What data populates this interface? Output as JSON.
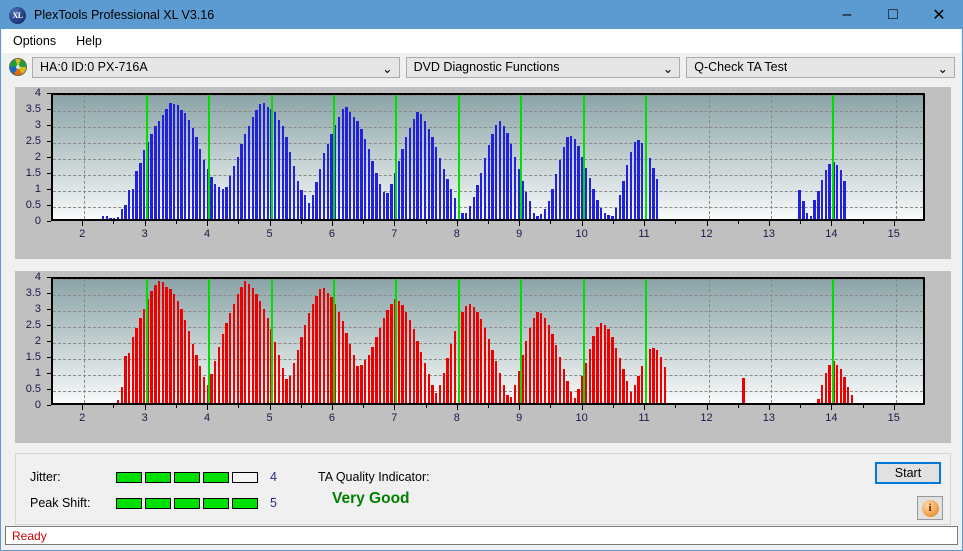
{
  "window": {
    "title": "PlexTools Professional XL V3.16",
    "icon": "XL",
    "minimize": "–",
    "maximize": "□",
    "close": "✕"
  },
  "menubar": {
    "items": [
      {
        "label": "Options"
      },
      {
        "label": "Help"
      }
    ]
  },
  "toolbar": {
    "drive_icon": "disc-icon",
    "drive_select": {
      "value": "HA:0 ID:0  PX-716A",
      "chevron": "⌄"
    },
    "function_select": {
      "value": "DVD Diagnostic Functions",
      "chevron": "⌄"
    },
    "test_select": {
      "value": "Q-Check TA Test",
      "chevron": "⌄"
    }
  },
  "indicators": {
    "jitter": {
      "label": "Jitter:",
      "value": "4",
      "filled": 4,
      "total": 5
    },
    "peak_shift": {
      "label": "Peak Shift:",
      "value": "5",
      "filled": 5,
      "total": 5
    },
    "ta_quality": {
      "label": "TA Quality Indicator:",
      "value": "Very Good",
      "color": "#008000"
    }
  },
  "buttons": {
    "start": "Start",
    "info": "i"
  },
  "status": {
    "text": "Ready"
  },
  "chart_data": [
    {
      "id": "ta-test-pit-lengths",
      "type": "bar",
      "title": "",
      "xlabel": "",
      "ylabel": "",
      "color": "#2222dd",
      "xlim": [
        1.5,
        15.5
      ],
      "ylim": [
        0,
        4
      ],
      "yticks": [
        0,
        0.5,
        1,
        1.5,
        2,
        2.5,
        3,
        3.5,
        4
      ],
      "ytick_labels": [
        "0",
        "0.5",
        "1",
        "1.5",
        "2",
        "2.5",
        "3",
        "3.5",
        "4"
      ],
      "xticks": [
        2,
        3,
        4,
        5,
        6,
        7,
        8,
        9,
        10,
        11,
        12,
        13,
        14,
        15
      ],
      "xtick_labels": [
        "2",
        "3",
        "4",
        "5",
        "6",
        "7",
        "8",
        "9",
        "10",
        "11",
        "12",
        "13",
        "14",
        "15"
      ],
      "grid": true,
      "markers": [
        3,
        4,
        5,
        6,
        7,
        8,
        9,
        10,
        11,
        14
      ],
      "marker_color": "#00e000",
      "x": [
        2.3,
        2.36,
        2.42,
        2.48,
        2.54,
        2.6,
        2.66,
        2.72,
        2.78,
        2.84,
        2.9,
        2.96,
        3.02,
        3.08,
        3.14,
        3.2,
        3.26,
        3.32,
        3.38,
        3.44,
        3.5,
        3.56,
        3.62,
        3.68,
        3.74,
        3.8,
        3.86,
        3.92,
        3.98,
        4.04,
        4.1,
        4.16,
        4.22,
        4.28,
        4.34,
        4.4,
        4.46,
        4.52,
        4.58,
        4.64,
        4.7,
        4.76,
        4.82,
        4.88,
        4.94,
        5.0,
        5.06,
        5.12,
        5.18,
        5.24,
        5.3,
        5.36,
        5.42,
        5.48,
        5.54,
        5.6,
        5.66,
        5.72,
        5.78,
        5.84,
        5.9,
        5.96,
        6.02,
        6.08,
        6.14,
        6.2,
        6.26,
        6.32,
        6.38,
        6.44,
        6.5,
        6.56,
        6.62,
        6.68,
        6.74,
        6.8,
        6.86,
        6.92,
        6.98,
        7.04,
        7.1,
        7.16,
        7.22,
        7.28,
        7.34,
        7.4,
        7.46,
        7.52,
        7.58,
        7.64,
        7.7,
        7.76,
        7.82,
        7.88,
        7.94,
        8.0,
        8.06,
        8.12,
        8.18,
        8.24,
        8.3,
        8.36,
        8.42,
        8.48,
        8.54,
        8.6,
        8.66,
        8.72,
        8.78,
        8.84,
        8.9,
        8.96,
        9.02,
        9.08,
        9.14,
        9.2,
        9.26,
        9.32,
        9.38,
        9.44,
        9.5,
        9.56,
        9.62,
        9.68,
        9.74,
        9.8,
        9.86,
        9.92,
        9.98,
        10.04,
        10.1,
        10.16,
        10.22,
        10.28,
        10.34,
        10.4,
        10.46,
        10.52,
        10.58,
        10.64,
        10.7,
        10.76,
        10.82,
        10.88,
        10.94,
        11.0,
        11.06,
        11.12,
        11.18,
        13.46,
        13.52,
        13.58,
        13.64,
        13.7,
        13.76,
        13.82,
        13.88,
        13.94,
        14.0,
        14.06,
        14.12,
        14.18
      ],
      "values": [
        0.08,
        0.08,
        0.02,
        0.02,
        0.06,
        0.3,
        0.45,
        0.9,
        0.95,
        1.5,
        1.75,
        2.15,
        2.4,
        2.65,
        2.9,
        3.05,
        3.25,
        3.45,
        3.62,
        3.6,
        3.55,
        3.4,
        3.3,
        3.1,
        2.85,
        2.55,
        2.2,
        1.85,
        1.55,
        1.3,
        1.1,
        1.0,
        0.95,
        1.0,
        1.35,
        1.65,
        1.95,
        2.35,
        2.65,
        2.9,
        3.2,
        3.4,
        3.58,
        3.62,
        3.5,
        3.45,
        3.35,
        3.1,
        2.9,
        2.55,
        2.1,
        1.65,
        1.2,
        0.9,
        0.75,
        0.5,
        0.75,
        1.15,
        1.55,
        2.05,
        2.35,
        2.65,
        2.95,
        3.2,
        3.45,
        3.5,
        3.35,
        3.2,
        3.05,
        2.8,
        2.5,
        2.2,
        1.8,
        1.45,
        1.1,
        0.85,
        0.8,
        1.1,
        1.45,
        1.8,
        2.2,
        2.55,
        2.85,
        3.12,
        3.35,
        3.28,
        3.05,
        2.8,
        2.55,
        2.25,
        1.9,
        1.55,
        1.25,
        0.95,
        0.65,
        0.4,
        0.2,
        0.18,
        0.4,
        0.7,
        1.05,
        1.45,
        1.9,
        2.3,
        2.65,
        2.95,
        3.05,
        2.9,
        2.7,
        2.35,
        1.95,
        1.55,
        1.2,
        0.85,
        0.55,
        0.2,
        0.1,
        0.15,
        0.3,
        0.55,
        0.95,
        1.4,
        1.85,
        2.25,
        2.55,
        2.6,
        2.5,
        2.28,
        1.95,
        1.6,
        1.28,
        0.95,
        0.6,
        0.35,
        0.18,
        0.12,
        0.1,
        0.35,
        0.75,
        1.2,
        1.7,
        2.1,
        2.4,
        2.48,
        2.38,
        2.18,
        1.9,
        1.58,
        1.25,
        0.9,
        0.55,
        0.2,
        0.08,
        0.6,
        0.88,
        1.22,
        1.52,
        1.72,
        1.78,
        1.7,
        1.52,
        1.2,
        0.85,
        0.55,
        0.25,
        0.08
      ]
    },
    {
      "id": "ta-test-land-lengths",
      "type": "bar",
      "title": "",
      "xlabel": "",
      "ylabel": "",
      "color": "#ee0000",
      "xlim": [
        1.5,
        15.5
      ],
      "ylim": [
        0,
        4
      ],
      "yticks": [
        0,
        0.5,
        1,
        1.5,
        2,
        2.5,
        3,
        3.5,
        4
      ],
      "ytick_labels": [
        "0",
        "0.5",
        "1",
        "1.5",
        "2",
        "2.5",
        "3",
        "3.5",
        "4"
      ],
      "xticks": [
        2,
        3,
        4,
        5,
        6,
        7,
        8,
        9,
        10,
        11,
        12,
        13,
        14,
        15
      ],
      "xtick_labels": [
        "2",
        "3",
        "4",
        "5",
        "6",
        "7",
        "8",
        "9",
        "10",
        "11",
        "12",
        "13",
        "14",
        "15"
      ],
      "grid": true,
      "markers": [
        3,
        4,
        5,
        6,
        7,
        8,
        9,
        10,
        11,
        14
      ],
      "marker_color": "#00e000",
      "x": [
        2.54,
        2.6,
        2.66,
        2.72,
        2.78,
        2.84,
        2.9,
        2.96,
        3.02,
        3.08,
        3.14,
        3.2,
        3.26,
        3.32,
        3.38,
        3.44,
        3.5,
        3.56,
        3.62,
        3.68,
        3.74,
        3.8,
        3.86,
        3.92,
        3.98,
        4.04,
        4.1,
        4.16,
        4.22,
        4.28,
        4.34,
        4.4,
        4.46,
        4.52,
        4.58,
        4.64,
        4.7,
        4.76,
        4.82,
        4.88,
        4.94,
        5.0,
        5.06,
        5.12,
        5.18,
        5.24,
        5.3,
        5.36,
        5.42,
        5.48,
        5.54,
        5.6,
        5.66,
        5.72,
        5.78,
        5.84,
        5.9,
        5.96,
        6.02,
        6.08,
        6.14,
        6.2,
        6.26,
        6.32,
        6.38,
        6.44,
        6.5,
        6.56,
        6.62,
        6.68,
        6.74,
        6.8,
        6.86,
        6.92,
        6.98,
        7.04,
        7.1,
        7.16,
        7.22,
        7.28,
        7.34,
        7.4,
        7.46,
        7.52,
        7.58,
        7.64,
        7.7,
        7.76,
        7.82,
        7.88,
        7.94,
        8.0,
        8.06,
        8.12,
        8.18,
        8.24,
        8.3,
        8.36,
        8.42,
        8.48,
        8.54,
        8.6,
        8.66,
        8.72,
        8.78,
        8.84,
        8.9,
        8.96,
        9.02,
        9.08,
        9.14,
        9.2,
        9.26,
        9.32,
        9.38,
        9.44,
        9.5,
        9.56,
        9.62,
        9.68,
        9.74,
        9.8,
        9.86,
        9.92,
        9.98,
        10.04,
        10.1,
        10.16,
        10.22,
        10.28,
        10.34,
        10.4,
        10.46,
        10.52,
        10.58,
        10.64,
        10.7,
        10.76,
        10.82,
        10.88,
        10.94,
        11.0,
        11.06,
        11.12,
        11.18,
        11.24,
        11.3,
        12.56,
        13.76,
        13.82,
        13.88,
        13.94,
        14.0,
        14.06,
        14.12,
        14.18,
        14.24,
        14.3
      ],
      "values": [
        0.1,
        0.5,
        1.48,
        1.55,
        2.05,
        2.35,
        2.65,
        2.95,
        3.25,
        3.5,
        3.7,
        3.8,
        3.78,
        3.62,
        3.55,
        3.4,
        3.2,
        2.95,
        2.6,
        2.25,
        1.85,
        1.5,
        1.15,
        0.8,
        0.55,
        0.9,
        1.3,
        1.75,
        2.15,
        2.5,
        2.8,
        3.1,
        3.4,
        3.62,
        3.8,
        3.72,
        3.58,
        3.4,
        3.2,
        2.95,
        2.65,
        2.3,
        1.9,
        1.5,
        1.1,
        0.75,
        0.85,
        1.25,
        1.65,
        2.05,
        2.45,
        2.8,
        3.1,
        3.35,
        3.55,
        3.58,
        3.45,
        3.3,
        3.1,
        2.85,
        2.55,
        2.2,
        1.85,
        1.5,
        1.15,
        1.2,
        1.35,
        1.5,
        1.75,
        2.05,
        2.35,
        2.65,
        2.9,
        3.1,
        3.25,
        3.2,
        3.05,
        2.85,
        2.6,
        2.3,
        1.95,
        1.6,
        1.25,
        0.9,
        0.55,
        0.3,
        0.55,
        0.95,
        1.4,
        1.85,
        2.25,
        2.6,
        2.85,
        3.02,
        3.1,
        3.0,
        2.85,
        2.62,
        2.35,
        2.0,
        1.65,
        1.3,
        0.95,
        0.55,
        0.25,
        0.2,
        0.55,
        1.0,
        1.5,
        1.95,
        2.35,
        2.65,
        2.85,
        2.8,
        2.65,
        2.45,
        2.15,
        1.8,
        1.45,
        1.05,
        0.7,
        0.35,
        0.15,
        0.45,
        0.85,
        1.25,
        1.7,
        2.1,
        2.38,
        2.5,
        2.45,
        2.3,
        2.05,
        1.72,
        1.4,
        1.05,
        0.7,
        0.35,
        0.55,
        0.85,
        1.15,
        1.45,
        1.68,
        1.72,
        1.65,
        1.45,
        1.12,
        0.78,
        0.12,
        0.55,
        0.95,
        1.2,
        1.32,
        1.2,
        1.05,
        0.8,
        0.5,
        0.25,
        0.1
      ]
    }
  ]
}
